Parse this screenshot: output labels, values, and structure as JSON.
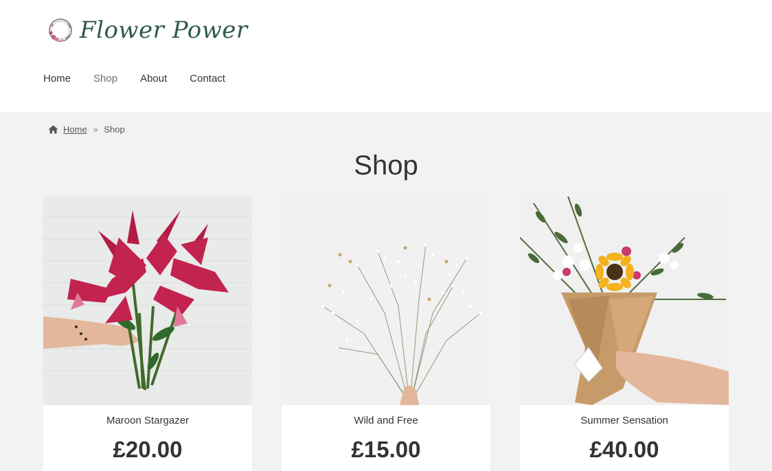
{
  "site": {
    "logo_text": "Flower Power"
  },
  "nav": {
    "items": [
      {
        "label": "Home"
      },
      {
        "label": "Shop"
      },
      {
        "label": "About"
      },
      {
        "label": "Contact"
      }
    ],
    "active": "Shop"
  },
  "breadcrumb": {
    "home": "Home",
    "separator": "»",
    "current": "Shop"
  },
  "page": {
    "title": "Shop"
  },
  "products": [
    {
      "name": "Maroon Stargazer",
      "price": "£20.00",
      "image": "red-lily-bouquet"
    },
    {
      "name": "Wild and Free",
      "price": "£15.00",
      "image": "babys-breath-bouquet"
    },
    {
      "name": "Summer Sensation",
      "price": "£40.00",
      "image": "sunflower-kraft-bouquet"
    }
  ],
  "colors": {
    "brand": "#2f5a4e",
    "background": "#f2f2f2",
    "text": "#333333"
  }
}
